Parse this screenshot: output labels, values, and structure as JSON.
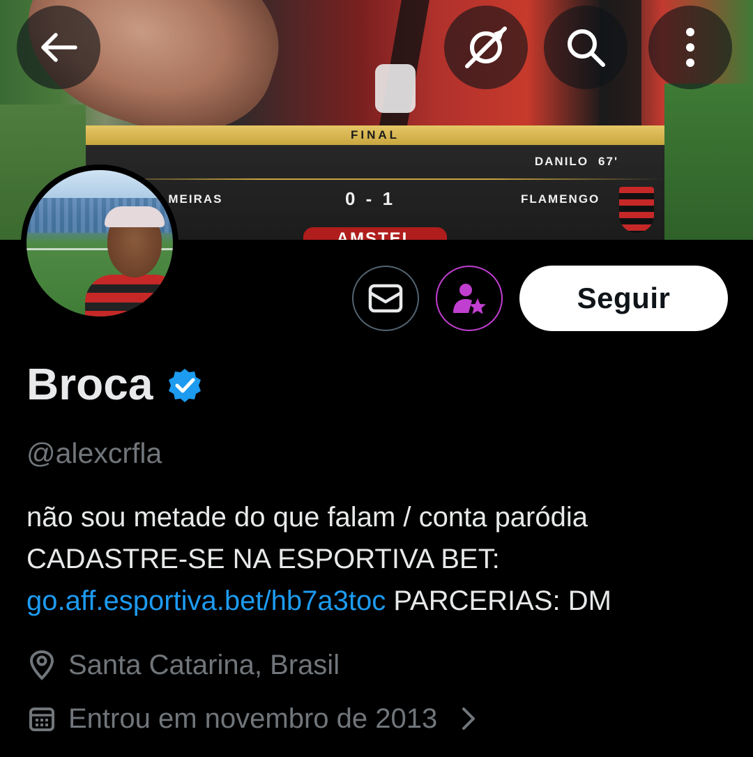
{
  "banner": {
    "scoreboard": {
      "stage": "FINAL",
      "scorer": "DANILO",
      "minute": "67'",
      "home_team": "LMEIRAS",
      "score": "0 - 1",
      "away_team": "FLAMENGO",
      "sponsor": "AMSTEL"
    }
  },
  "top_bar": {
    "back_icon": "arrow-left-icon",
    "grok_icon": "grok-icon",
    "search_icon": "search-icon",
    "more_icon": "more-vertical-icon"
  },
  "actions": {
    "message_icon": "envelope-icon",
    "subscribe_icon": "person-star-icon",
    "follow_label": "Seguir"
  },
  "profile": {
    "display_name": "Broca",
    "verified": true,
    "handle": "@alexcrfla",
    "bio_part1": "não sou metade do que falam / conta paródia  CADASTRE-SE NA ESPORTIVA BET: ",
    "bio_link": "go.aff.esportiva.bet/hb7a3toc",
    "bio_part2": " PARCERIAS: DM",
    "location": "Santa Catarina, Brasil",
    "joined": "Entrou em novembro de 2013"
  },
  "colors": {
    "background": "#000000",
    "text_primary": "#e7e9ea",
    "text_secondary": "#71767b",
    "link": "#1d9bf0",
    "verified": "#1d9bf0",
    "subscribe_accent": "#c13fd0",
    "follow_button_bg": "#ffffff"
  }
}
